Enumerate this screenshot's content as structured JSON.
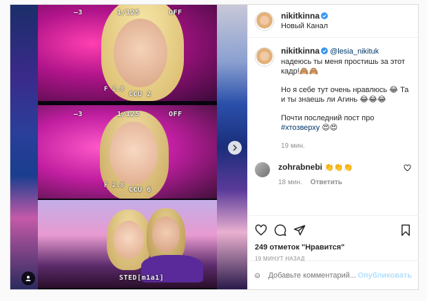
{
  "post": {
    "username": "nikitkinna",
    "location": "Новый Канал",
    "caption": {
      "line1_mention": "@lesia_nikituk",
      "line1_rest": " надеюсь ты меня простишь за этот кадр!🙈🙈",
      "para2": "Но я себе тут очень нравлюсь 😂 Та и ты знаешь ли Агинь 😂😂😂",
      "para3_text": "Почти последний пост про ",
      "para3_hashtag": "#хтозверху",
      "para3_emoji": " 😍😍"
    },
    "caption_time": "19 мин.",
    "reply": {
      "username": "zohrabnebi",
      "text": " 👏👏👏",
      "time": "18 мин.",
      "reply_label": "Ответить"
    },
    "likes": "249 отметок \"Нравится\"",
    "posted_ago": "19 МИНУТ НАЗАД",
    "comment_placeholder": "Добавьте комментарий...",
    "publish_label": "Опубликовать"
  },
  "media": {
    "tiles": [
      {
        "top_left": "–3",
        "top_mid": "1/125",
        "top_right": "OFF",
        "f": "F 2.8",
        "cam": "CCU 2"
      },
      {
        "top_left": "–3",
        "top_mid": "1/125",
        "top_right": "OFF",
        "f": "F 2.8",
        "cam": "CCU 6"
      },
      {
        "cam": "STED[m1a1]"
      }
    ]
  },
  "colors": {
    "link": "#00376b",
    "verified": "#3897f0",
    "muted": "#8e8e8e",
    "publish_disabled": "#b2dffc"
  },
  "icons": [
    "verified-icon",
    "heart-icon",
    "comment-icon",
    "share-icon",
    "bookmark-icon",
    "emoji-icon",
    "chevron-right-icon",
    "user-tag-icon"
  ]
}
